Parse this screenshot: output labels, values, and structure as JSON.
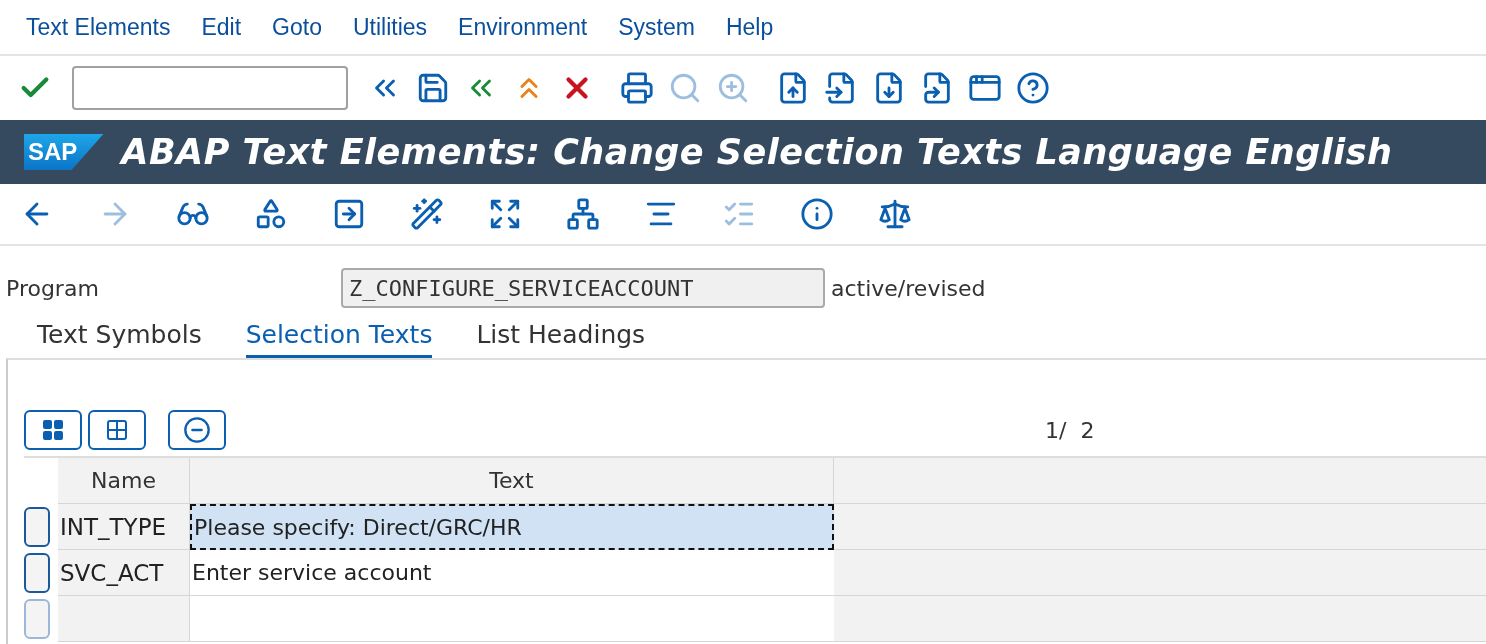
{
  "menu": [
    "Text Elements",
    "Edit",
    "Goto",
    "Utilities",
    "Environment",
    "System",
    "Help"
  ],
  "toolbar": [
    {
      "disabled": false
    },
    {
      "disabled": false
    },
    {
      "disabled": false
    },
    {
      "disabled": false
    },
    {
      "disabled": false
    },
    {
      "disabled": false
    },
    {
      "disabled": false
    },
    {
      "disabled": true
    },
    {
      "disabled": true
    },
    {
      "disabled": false
    },
    {
      "disabled": false
    },
    {
      "disabled": false
    },
    {
      "disabled": false
    },
    {
      "disabled": false
    },
    {
      "disabled": false
    }
  ],
  "title_bar": {
    "logo": "SAP",
    "title": "ABAP Text Elements: Change Selection Texts Language English"
  },
  "app_toolbar": [
    {
      "disabled": false
    },
    {
      "disabled": true
    },
    {
      "disabled": false
    },
    {
      "disabled": false
    },
    {
      "disabled": false
    },
    {
      "disabled": false
    },
    {
      "disabled": false
    },
    {
      "disabled": false
    },
    {
      "disabled": false
    },
    {
      "disabled": true
    },
    {
      "disabled": false
    },
    {
      "disabled": false
    }
  ],
  "program": {
    "label": "Program",
    "value": "Z_CONFIGURE_SERVICEACCOUNT",
    "status": "active/revised"
  },
  "tabs": [
    {
      "label": "Text Symbols",
      "selected": false
    },
    {
      "label": "Selection Texts",
      "selected": true
    },
    {
      "label": "List Headings",
      "selected": false
    }
  ],
  "page_indicator": "1/  2",
  "table": {
    "columns": [
      "Name",
      "Text"
    ],
    "rows": [
      {
        "name": "INT_TYPE",
        "text": "Please specify: Direct/GRC/HR",
        "selected": true
      },
      {
        "name": "SVC_ACT",
        "text": "Enter service account",
        "selected": false
      }
    ]
  }
}
